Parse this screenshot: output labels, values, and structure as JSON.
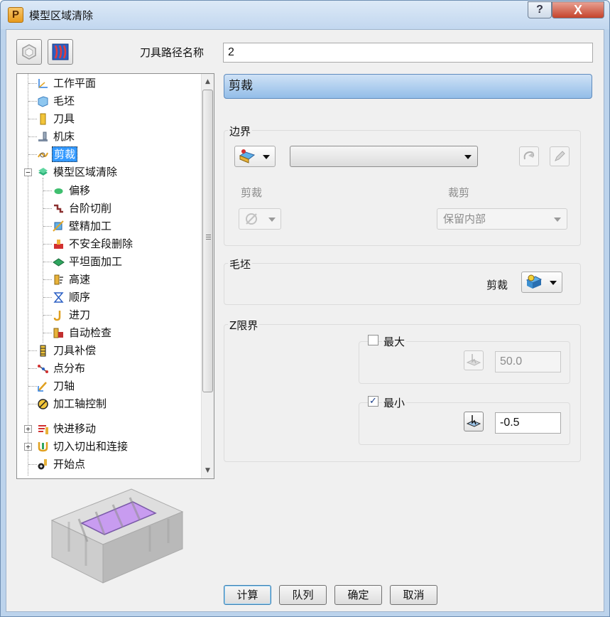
{
  "window": {
    "title": "模型区域清除",
    "app_icon_letter": "P",
    "help_label": "?",
    "close_label": "X"
  },
  "toolbar": {
    "toolpath_name_label": "刀具路径名称",
    "toolpath_name_value": "2"
  },
  "tree": {
    "items": [
      {
        "label": "工作平面",
        "icon": "workplane-icon"
      },
      {
        "label": "毛坯",
        "icon": "block-icon"
      },
      {
        "label": "刀具",
        "icon": "tool-icon"
      },
      {
        "label": "机床",
        "icon": "machine-icon"
      },
      {
        "label": "剪裁",
        "icon": "trim-icon",
        "selected": true
      },
      {
        "label": "模型区域清除",
        "icon": "area-clearance-icon",
        "expanded": true
      },
      {
        "label": "偏移",
        "icon": "offset-icon"
      },
      {
        "label": "台阶切削",
        "icon": "step-cutting-icon"
      },
      {
        "label": "壁精加工",
        "icon": "wall-finishing-icon"
      },
      {
        "label": "不安全段删除",
        "icon": "unsafe-segment-icon"
      },
      {
        "label": "平坦面加工",
        "icon": "flat-machining-icon"
      },
      {
        "label": "高速",
        "icon": "high-speed-icon"
      },
      {
        "label": "顺序",
        "icon": "order-icon"
      },
      {
        "label": "进刀",
        "icon": "approach-icon"
      },
      {
        "label": "自动检查",
        "icon": "auto-verify-icon"
      },
      {
        "label": "刀具补偿",
        "icon": "tool-compensation-icon"
      },
      {
        "label": "点分布",
        "icon": "point-distribution-icon"
      },
      {
        "label": "刀轴",
        "icon": "tool-axis-icon"
      },
      {
        "label": "加工轴控制",
        "icon": "axis-control-icon"
      },
      {
        "label": "快进移动",
        "icon": "rapid-move-icon"
      },
      {
        "label": "切入切出和连接",
        "icon": "leads-links-icon"
      },
      {
        "label": "开始点",
        "icon": "start-point-icon"
      }
    ]
  },
  "panel": {
    "header": "剪裁",
    "boundary": {
      "title": "边界",
      "select_value": "",
      "trim_label": "剪裁",
      "clip_label": "裁剪",
      "clip_value": "保留内部"
    },
    "block": {
      "title": "毛坯",
      "trim_label": "剪裁"
    },
    "zlimits": {
      "title": "Z限界",
      "max_label": "最大",
      "max_checked": false,
      "max_value": "50.0",
      "min_label": "最小",
      "min_checked": true,
      "min_value": "-0.5",
      "check_mark": "✓"
    }
  },
  "buttons": {
    "calculate": "计算",
    "queue": "队列",
    "accept": "确定",
    "cancel": "取消"
  },
  "colors": {
    "selection": "#3399ff",
    "header_bar": "#93bde8",
    "trim_region": "#c89cf0"
  }
}
